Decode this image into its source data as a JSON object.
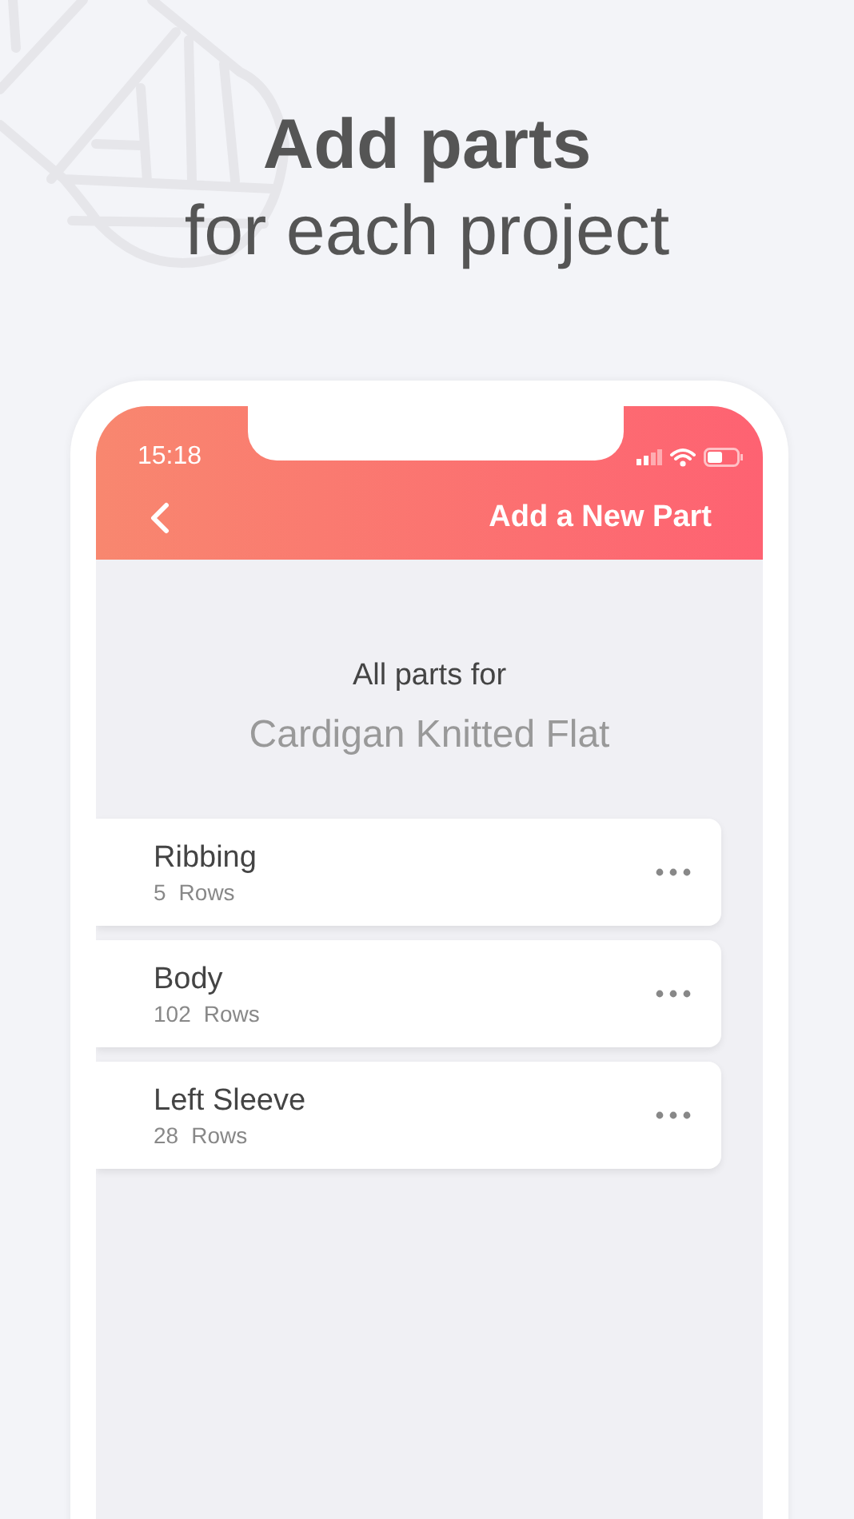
{
  "headline": {
    "title": "Add parts",
    "subtitle": "for each project"
  },
  "status_bar": {
    "time": "15:18"
  },
  "nav_bar": {
    "title": "Add a New Part"
  },
  "intro": {
    "label": "All parts for",
    "project": "Cardigan Knitted Flat"
  },
  "parts": [
    {
      "name": "Ribbing",
      "count": "5",
      "unit": "Rows"
    },
    {
      "name": "Body",
      "count": "102",
      "unit": "Rows"
    },
    {
      "name": "Left Sleeve",
      "count": "28",
      "unit": "Rows"
    }
  ]
}
